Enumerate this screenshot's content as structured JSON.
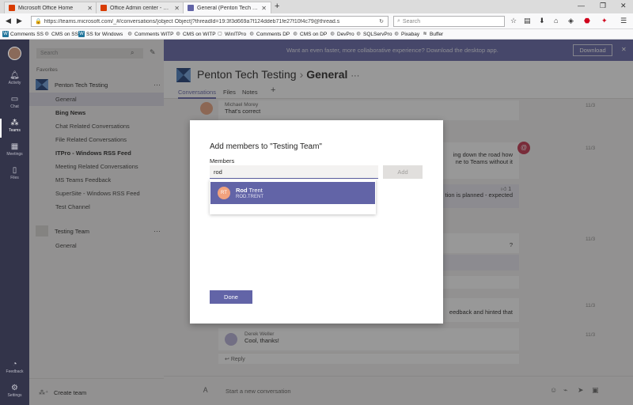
{
  "browser": {
    "tabs": [
      {
        "label": "Microsoft Office Home",
        "icon": "office-icon",
        "color": "#d83b01"
      },
      {
        "label": "Office Admin center - Gro...",
        "icon": "office-icon",
        "color": "#d83b01"
      },
      {
        "label": "General (Penton Tech Test...",
        "icon": "teams-icon",
        "color": "#6264a7"
      }
    ],
    "new_tab": "+",
    "url": "https://teams.microsoft.com/_#/conversations/[object Object]?threadId=19:3f3d669a7f124ddeb71fe27f10f4c79@thread.s",
    "search_placeholder": "Search",
    "bookmarks": [
      {
        "label": "Comments SS",
        "icon": "wp-icon",
        "color": "#21759b"
      },
      {
        "label": "CMS on SS",
        "icon": "globe-icon",
        "color": "#555555"
      },
      {
        "label": "SS for Windows",
        "icon": "wp-icon",
        "color": "#21759b"
      },
      {
        "label": "Comments WITP",
        "icon": "globe-icon",
        "color": "#555555"
      },
      {
        "label": "CMS on WITP",
        "icon": "globe-icon",
        "color": "#555555"
      },
      {
        "label": "WinITPro",
        "icon": "doc-icon",
        "color": "#555555"
      },
      {
        "label": "Comments DP",
        "icon": "globe-icon",
        "color": "#555555"
      },
      {
        "label": "CMS on DP",
        "icon": "globe-icon",
        "color": "#555555"
      },
      {
        "label": "DevPro",
        "icon": "globe-icon",
        "color": "#555555"
      },
      {
        "label": "SQLServPro",
        "icon": "globe-icon",
        "color": "#555555"
      },
      {
        "label": "Pixabay",
        "icon": "globe-icon",
        "color": "#555555"
      },
      {
        "label": "Buffer",
        "icon": "stack-icon",
        "color": "#222222"
      }
    ]
  },
  "rail": {
    "items": [
      {
        "label": "Activity",
        "icon": "bell-icon"
      },
      {
        "label": "Chat",
        "icon": "chat-icon"
      },
      {
        "label": "Teams",
        "icon": "teams-icon"
      },
      {
        "label": "Meetings",
        "icon": "calendar-icon"
      },
      {
        "label": "Files",
        "icon": "file-icon"
      }
    ],
    "feedback": "Feedback",
    "settings": "Settings"
  },
  "team_list": {
    "search_placeholder": "Search",
    "favorites_label": "Favorites",
    "teams": [
      {
        "name": "Penton Tech Testing",
        "channels": [
          {
            "name": "General",
            "selected": true,
            "bold": false
          },
          {
            "name": "Bing News",
            "selected": false,
            "bold": true
          },
          {
            "name": "Chat Related Conversations",
            "selected": false,
            "bold": false
          },
          {
            "name": "File Related Conversations",
            "selected": false,
            "bold": false
          },
          {
            "name": "ITPro - Windows RSS Feed",
            "selected": false,
            "bold": true
          },
          {
            "name": "Meeting Related Conversations",
            "selected": false,
            "bold": false
          },
          {
            "name": "MS Teams Feedback",
            "selected": false,
            "bold": false
          },
          {
            "name": "SuperSite - Windows RSS Feed",
            "selected": false,
            "bold": false
          },
          {
            "name": "Test Channel",
            "selected": false,
            "bold": false
          }
        ]
      },
      {
        "name": "Testing Team",
        "channels": [
          {
            "name": "General",
            "selected": false,
            "bold": false
          }
        ]
      }
    ],
    "create_team": "Create team"
  },
  "main": {
    "banner_text": "Want an even faster, more collaborative experience? Download the desktop app.",
    "download_label": "Download",
    "team_name": "Penton Tech Testing",
    "channel_name": "General",
    "tabs": [
      "Conversations",
      "Files",
      "Notes"
    ],
    "messages": [
      {
        "author": "Michael Morey",
        "text": "That's correct",
        "time": "11/3"
      },
      {
        "author": "",
        "text": "ing down the road how",
        "text2": "ne to Teams without it",
        "time": "11/3"
      },
      {
        "author": "",
        "text": "tion is planned - expected",
        "time": "",
        "likes": "1"
      },
      {
        "author": "",
        "text": "?",
        "time": "11/3"
      },
      {
        "author": "",
        "text": "eedback and hinted that",
        "time": "11/3"
      },
      {
        "author": "Derek Weller",
        "text": "Cool, thanks!",
        "time": "11/3"
      }
    ],
    "reply_label": "Reply",
    "compose_placeholder": "Start a new conversation"
  },
  "modal": {
    "title": "Add members to \"Testing Team\"",
    "members_label": "Members",
    "input_value": "rod",
    "add_label": "Add",
    "suggestion": {
      "initials": "RT",
      "first": "Rod",
      "last": "Trent",
      "id": "ROD.TRENT"
    },
    "done_label": "Done"
  },
  "colors": {
    "brand": "#6264a7",
    "rail": "#33344a",
    "mention": "#c4314b"
  }
}
